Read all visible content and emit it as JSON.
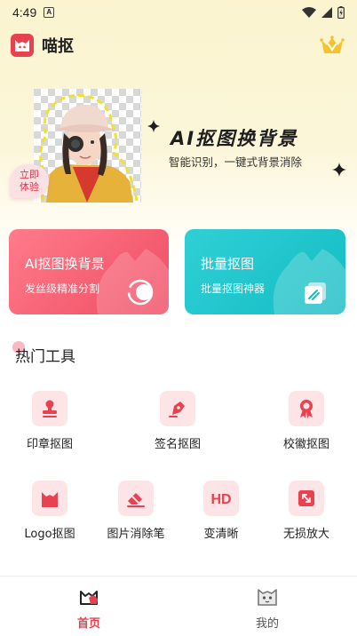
{
  "status_bar": {
    "time": "4:49",
    "sim_label": "A"
  },
  "app": {
    "name": "喵抠"
  },
  "hero": {
    "title": "AI抠图换背景",
    "subtitle": "智能识别，一键式背景消除",
    "badge_line1": "立即",
    "badge_line2": "体验"
  },
  "cards": [
    {
      "title": "AI抠图换背景",
      "subtitle": "发丝级精准分割",
      "color": "#ef4d63"
    },
    {
      "title": "批量抠图",
      "subtitle": "批量抠图神器",
      "color": "#14bcc4"
    }
  ],
  "section": {
    "title": "热门工具"
  },
  "tools": [
    {
      "label": "印章抠图",
      "icon": "stamp-icon"
    },
    {
      "label": "签名抠图",
      "icon": "signature-pen-icon"
    },
    {
      "label": "校徽抠图",
      "icon": "badge-icon"
    },
    {
      "label": "Logo抠图",
      "icon": "cat-logo-icon"
    },
    {
      "label": "图片消除笔",
      "icon": "eraser-icon"
    },
    {
      "label": "变清晰",
      "icon": "hd-icon"
    },
    {
      "label": "无损放大",
      "icon": "enlarge-icon"
    }
  ],
  "bottom_nav": {
    "home": "首页",
    "me": "我的",
    "active": "home"
  },
  "colors": {
    "accent": "#e8414f",
    "tile_bg": "#fde4e7",
    "teal": "#14bcc4"
  }
}
